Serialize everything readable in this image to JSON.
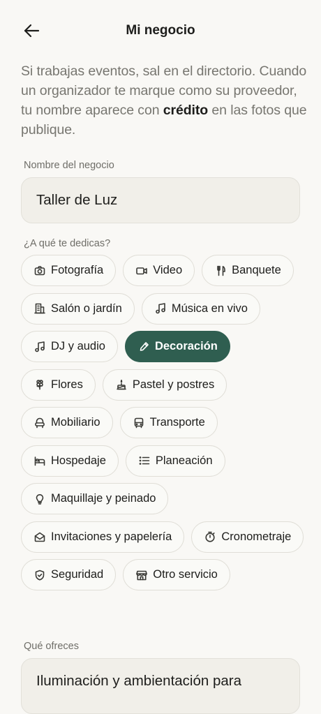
{
  "header": {
    "title": "Mi negocio"
  },
  "intro": {
    "text_before": "Si trabajas eventos, sal en el directorio. Cuando un organizador te marque como su proveedor, tu nombre aparece con ",
    "emphasis": "crédito",
    "text_after": " en las fotos que publique."
  },
  "business_name": {
    "label": "Nombre del negocio",
    "value": "Taller de Luz"
  },
  "categories": {
    "label": "¿A qué te dedicas?",
    "items": [
      {
        "label": "Fotografía",
        "icon": "camera-icon",
        "selected": false
      },
      {
        "label": "Video",
        "icon": "video-icon",
        "selected": false
      },
      {
        "label": "Banquete",
        "icon": "utensils-icon",
        "selected": false
      },
      {
        "label": "Salón o jardín",
        "icon": "building-icon",
        "selected": false
      },
      {
        "label": "Música en vivo",
        "icon": "music-note-icon",
        "selected": false
      },
      {
        "label": "DJ y audio",
        "icon": "music-note-icon",
        "selected": false
      },
      {
        "label": "Decoración",
        "icon": "brush-icon",
        "selected": true
      },
      {
        "label": "Flores",
        "icon": "flower-icon",
        "selected": false
      },
      {
        "label": "Pastel y postres",
        "icon": "cake-icon",
        "selected": false
      },
      {
        "label": "Mobiliario",
        "icon": "armchair-icon",
        "selected": false
      },
      {
        "label": "Transporte",
        "icon": "bus-icon",
        "selected": false
      },
      {
        "label": "Hospedaje",
        "icon": "bed-icon",
        "selected": false
      },
      {
        "label": "Planeación",
        "icon": "list-icon",
        "selected": false
      },
      {
        "label": "Maquillaje y peinado",
        "icon": "lightbulb-icon",
        "selected": false
      },
      {
        "label": "Invitaciones y papelería",
        "icon": "envelope-icon",
        "selected": false
      },
      {
        "label": "Cronometraje",
        "icon": "timer-icon",
        "selected": false
      },
      {
        "label": "Seguridad",
        "icon": "shield-icon",
        "selected": false
      },
      {
        "label": "Otro servicio",
        "icon": "store-icon",
        "selected": false
      }
    ]
  },
  "offers": {
    "label": "Qué ofreces",
    "value": "Iluminación y ambientación para"
  },
  "colors": {
    "accent": "#2f5e50",
    "background": "#f9f8f5",
    "field": "#f1efe9"
  }
}
